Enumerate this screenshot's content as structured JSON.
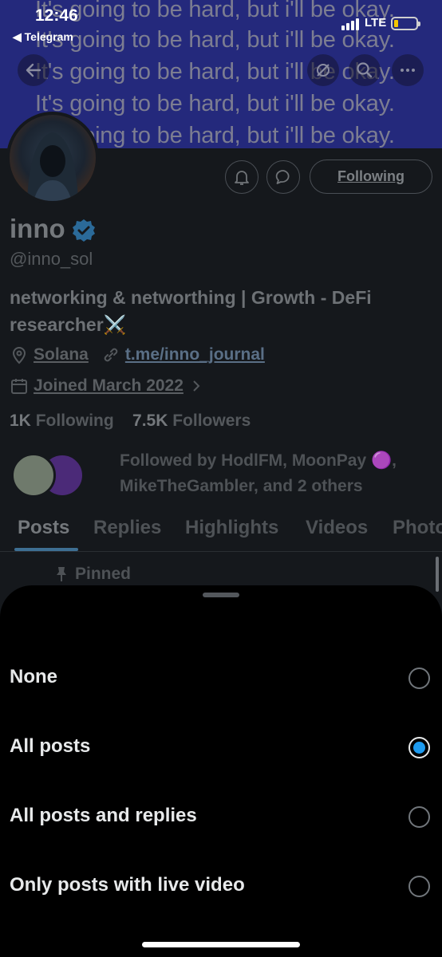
{
  "status_bar": {
    "time": "12:46",
    "back_app": "◀ Telegram",
    "network": "LTE"
  },
  "banner": {
    "lines": [
      "It's going to be hard, but i'll be okay.",
      "It's going to be hard, but i'll be okay.",
      "It's going to be hard, but i'll be okay.",
      "It's going to be hard, but i'll be okay.",
      "It's going to be hard, but i'll be okay."
    ]
  },
  "profile": {
    "name": "inno",
    "handle": "@inno_sol",
    "bio": "networking & networthing | Growth - DeFi researcher⚔️",
    "location": "Solana",
    "link": "t.me/inno_journal",
    "joined": "Joined March 2022",
    "following_count": "1K",
    "following_label": "Following",
    "followers_count": "7.5K",
    "followers_label": "Followers",
    "followed_by": "Followed by HodlFM, MoonPay 🟣, MikeTheGambler, and 2 others",
    "following_button": "Following"
  },
  "tabs": [
    "Posts",
    "Replies",
    "Highlights",
    "Videos",
    "Photos"
  ],
  "pinned_label": "Pinned",
  "sheet": {
    "options": [
      {
        "label": "None",
        "selected": false
      },
      {
        "label": "All posts",
        "selected": true
      },
      {
        "label": "All posts and replies",
        "selected": false
      },
      {
        "label": "Only posts with live video",
        "selected": false
      }
    ]
  },
  "colors": {
    "accent": "#1d9bf0",
    "banner": "#2a2f8e",
    "sheet_bg": "#000000"
  }
}
